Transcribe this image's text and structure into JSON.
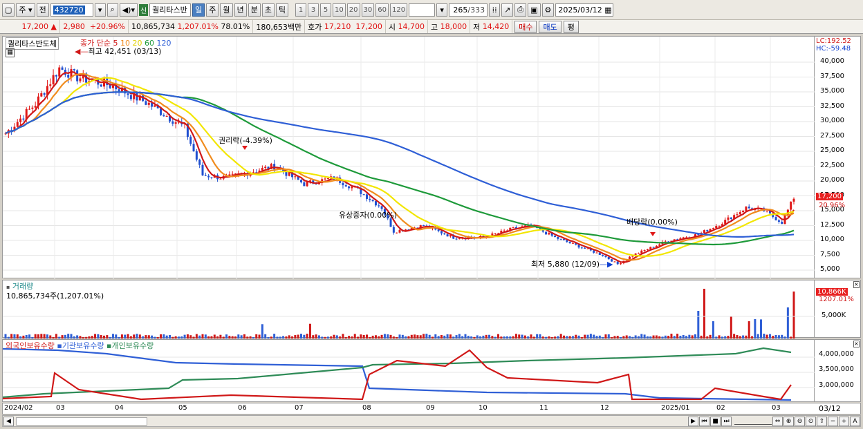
{
  "toolbar": {
    "mode1": "주",
    "mode2": "전",
    "code": "432720",
    "sin": "신",
    "stock_name": "퀄리타스반",
    "periods": [
      "일",
      "주",
      "월",
      "년",
      "분",
      "초",
      "틱"
    ],
    "intervals": [
      "1",
      "3",
      "5",
      "10",
      "20",
      "30",
      "60",
      "120"
    ],
    "count": "265",
    "total": "/333",
    "date": "2025/03/12"
  },
  "quote": {
    "price": "17,200",
    "arrow": "▲",
    "change": "2,980",
    "rate": "+20.96%",
    "volume": "10,865,734",
    "vol_rate": "1,207.01%",
    "turnover": "78.01%",
    "amount": "180,653백만",
    "ask_label": "호가",
    "ask": "17,210",
    "bid": "17,200",
    "open_label": "시",
    "open": "14,700",
    "high_label": "고",
    "high": "18,000",
    "low_label": "저",
    "low": "14,420",
    "buy": "매수",
    "sell": "매도",
    "eval": "평"
  },
  "price_panel": {
    "title": "퀄리타스반도체",
    "ma_label": "종가 단순",
    "ma_periods": [
      "5",
      "10",
      "20",
      "60",
      "120"
    ],
    "ma_colors": [
      "#d01818",
      "#f08c1e",
      "#f2e600",
      "#1e9a3a",
      "#2f5fd6"
    ],
    "high_note": "최고 42,451 (03/13)",
    "low_note": "최저 5,880 (12/09)",
    "event1": "권리락(-4.39%)",
    "event2": "유상증자(0.00%)",
    "event3": "배당락(0.00%)",
    "lc": "LC:192.52",
    "hc": "HC:-59.48",
    "current_price": "17,200",
    "current_rate": "20.96%",
    "y_ticks": [
      "40,000",
      "37,500",
      "35,000",
      "32,500",
      "30,000",
      "27,500",
      "25,000",
      "22,500",
      "20,000",
      "17,500",
      "15,000",
      "12,500",
      "10,000",
      "7,500",
      "5,000"
    ]
  },
  "volume_panel": {
    "title": "거래량",
    "value": "10,865,734주(1,207.01%)",
    "current": "10,866K",
    "current_rate": "1207.01%",
    "tick": "5,000K"
  },
  "holding_panel": {
    "labels": [
      "외국인보유수량",
      "기관보유수량",
      "개인보유수량"
    ],
    "colors": [
      "#d01818",
      "#2f5fd6",
      "#2e8b57"
    ],
    "ticks": [
      "4,000,000",
      "3,500,000",
      "3,000,000"
    ]
  },
  "x_axis": {
    "labels": [
      "2024/02",
      "03",
      "04",
      "05",
      "06",
      "07",
      "08",
      "09",
      "10",
      "11",
      "12",
      "2025/01",
      "02",
      "03"
    ],
    "right_label": "03/12"
  },
  "chart_data": {
    "type": "candlestick",
    "y_range": [
      3000,
      42500
    ],
    "events": [
      "권리락(-4.39%)",
      "유상증자(0.00%)",
      "배당락(0.00%)"
    ]
  }
}
